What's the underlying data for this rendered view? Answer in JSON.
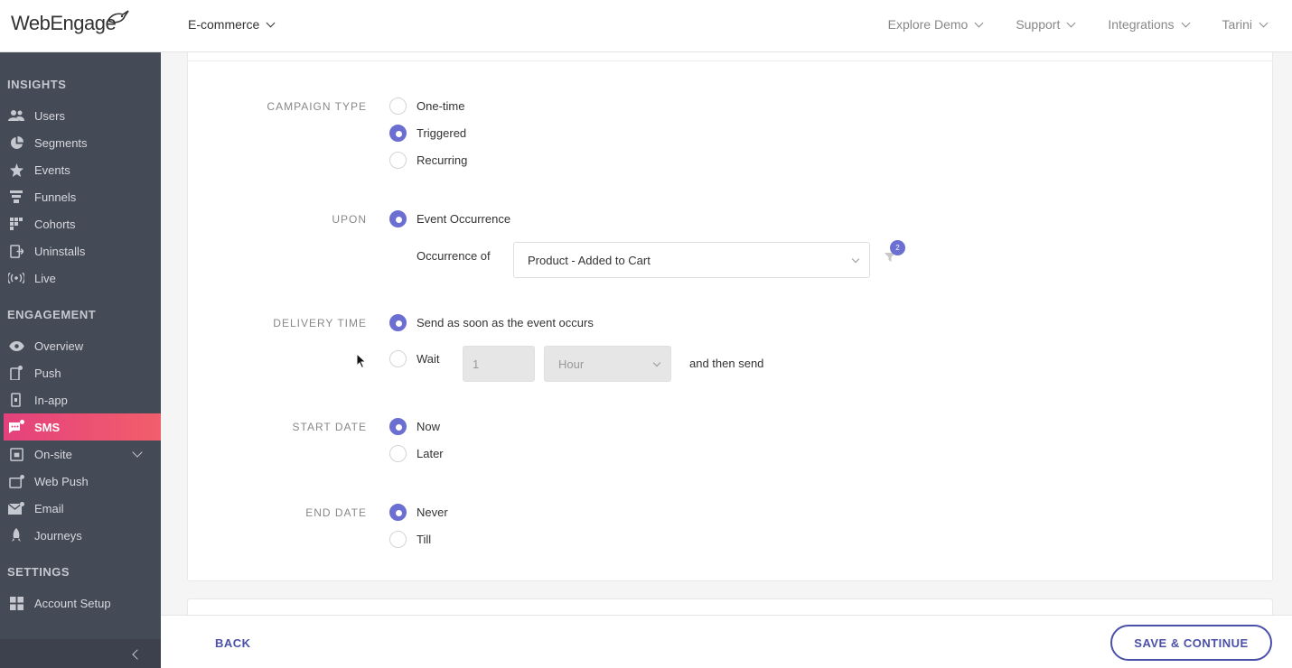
{
  "header": {
    "logo_text": "WebEngage",
    "project": "E-commerce",
    "nav": [
      "Explore Demo",
      "Support",
      "Integrations",
      "Tarini"
    ]
  },
  "sidebar": {
    "sections": [
      {
        "title": "INSIGHTS",
        "items": [
          {
            "label": "Users",
            "icon": "users-icon"
          },
          {
            "label": "Segments",
            "icon": "pie-icon"
          },
          {
            "label": "Events",
            "icon": "star-icon"
          },
          {
            "label": "Funnels",
            "icon": "funnel-icon"
          },
          {
            "label": "Cohorts",
            "icon": "grid-icon"
          },
          {
            "label": "Uninstalls",
            "icon": "uninstall-icon"
          },
          {
            "label": "Live",
            "icon": "live-icon"
          }
        ]
      },
      {
        "title": "ENGAGEMENT",
        "items": [
          {
            "label": "Overview",
            "icon": "eye-icon"
          },
          {
            "label": "Push",
            "icon": "push-icon"
          },
          {
            "label": "In-app",
            "icon": "in-app-icon"
          },
          {
            "label": "SMS",
            "icon": "sms-icon",
            "active": true
          },
          {
            "label": "On-site",
            "icon": "on-site-icon"
          },
          {
            "label": "Web Push",
            "icon": "web-push-icon"
          },
          {
            "label": "Email",
            "icon": "email-icon"
          },
          {
            "label": "Journeys",
            "icon": "journeys-icon"
          }
        ]
      },
      {
        "title": "SETTINGS",
        "items": [
          {
            "label": "Account Setup",
            "icon": "account-setup-icon"
          }
        ]
      }
    ]
  },
  "form": {
    "campaign_type": {
      "label": "CAMPAIGN TYPE",
      "options": [
        "One-time",
        "Triggered",
        "Recurring"
      ],
      "selected": "Triggered"
    },
    "upon": {
      "label": "UPON",
      "option": "Event Occurrence",
      "occurrence_label": "Occurrence of",
      "event": "Product - Added to Cart",
      "filter_count": "2"
    },
    "delivery_time": {
      "label": "DELIVERY TIME",
      "option_now": "Send as soon as the event occurs",
      "option_wait": "Wait",
      "wait_value": "1",
      "wait_unit": "Hour",
      "suffix": "and then send"
    },
    "start_date": {
      "label": "START DATE",
      "options": [
        "Now",
        "Later"
      ],
      "selected": "Now"
    },
    "end_date": {
      "label": "END DATE",
      "options": [
        "Never",
        "Till"
      ],
      "selected": "Never"
    }
  },
  "footer": {
    "back": "BACK",
    "save": "SAVE & CONTINUE"
  },
  "colors": {
    "accent": "#6a6fd1",
    "sidebar_bg": "#454a57",
    "active_gradient_start": "#e4417c",
    "active_gradient_end": "#f25e6b",
    "button": "#4a4fa8"
  }
}
